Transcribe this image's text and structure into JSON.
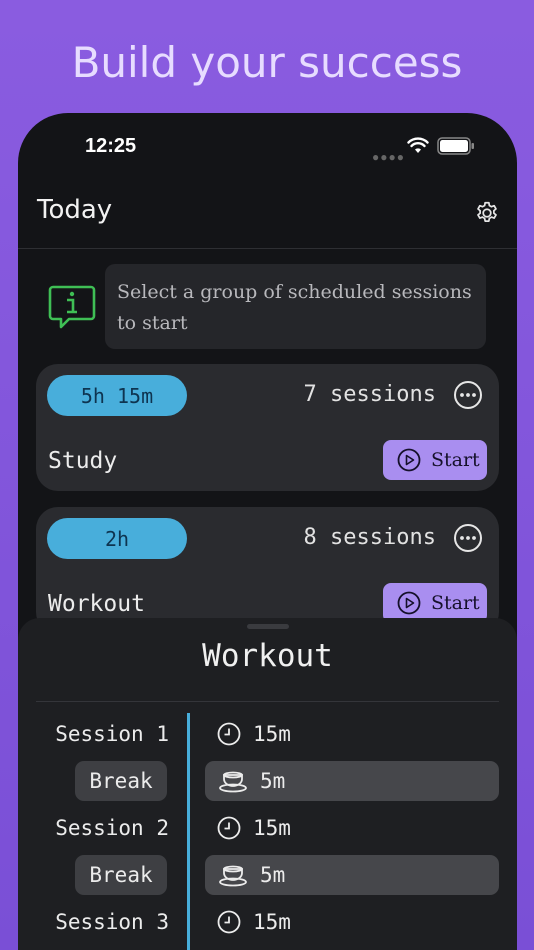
{
  "headline": "Build your success",
  "status_bar": {
    "time": "12:25"
  },
  "navbar": {
    "title": "Today"
  },
  "info": {
    "text": "Select a group of scheduled sessions to start"
  },
  "groups": [
    {
      "duration": "5h 15m",
      "sessions": "7 sessions",
      "name": "Study",
      "start_label": "Start"
    },
    {
      "duration": "2h",
      "sessions": "8 sessions",
      "name": "Workout",
      "start_label": "Start"
    }
  ],
  "sheet": {
    "title": "Workout",
    "rows": [
      {
        "label": "Session 1",
        "duration": "15m",
        "kind": "session"
      },
      {
        "label": "Break",
        "duration": "5m",
        "kind": "break"
      },
      {
        "label": "Session 2",
        "duration": "15m",
        "kind": "session"
      },
      {
        "label": "Break",
        "duration": "5m",
        "kind": "break"
      },
      {
        "label": "Session 3",
        "duration": "15m",
        "kind": "session"
      }
    ]
  },
  "colors": {
    "background": "#7a4fd6",
    "accent_blue": "#48aedb",
    "start_button": "#a98ef0",
    "info_icon": "#3fbf55"
  },
  "icons": {
    "wifi": "wifi-icon",
    "battery": "battery-icon",
    "settings": "gear-icon",
    "info": "info-bubble-icon",
    "more": "more-icon",
    "play": "play-icon",
    "clock": "clock-icon",
    "break": "coffee-cup-icon"
  }
}
